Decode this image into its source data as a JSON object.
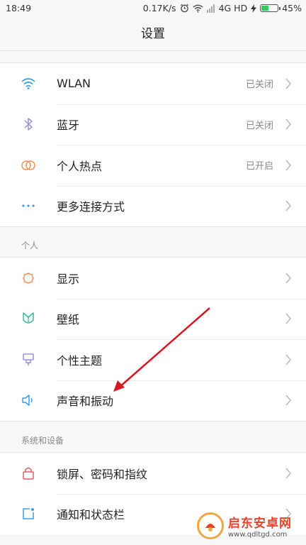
{
  "status_bar": {
    "time": "18:49",
    "net_speed": "0.17K/s",
    "network": "4G HD",
    "battery": "45%",
    "battery_level": 0.45
  },
  "header": {
    "title": "设置"
  },
  "groups": {
    "connection": [
      {
        "label": "WLAN",
        "value": "已关闭",
        "icon": "wifi-icon"
      },
      {
        "label": "蓝牙",
        "value": "已关闭",
        "icon": "bluetooth-icon"
      },
      {
        "label": "个人热点",
        "value": "已开启",
        "icon": "hotspot-icon"
      },
      {
        "label": "更多连接方式",
        "value": "",
        "icon": "more-icon"
      }
    ],
    "personal_title": "个人",
    "personal": [
      {
        "label": "显示",
        "icon": "display-icon"
      },
      {
        "label": "壁纸",
        "icon": "wallpaper-icon"
      },
      {
        "label": "个性主题",
        "icon": "theme-icon"
      },
      {
        "label": "声音和振动",
        "icon": "sound-icon"
      }
    ],
    "system_title": "系统和设备",
    "system": [
      {
        "label": "锁屏、密码和指纹",
        "icon": "lock-icon"
      },
      {
        "label": "通知和状态栏",
        "icon": "notification-icon"
      }
    ]
  },
  "watermark": {
    "title": "启东安卓网",
    "url": "www.qdltgd.com"
  },
  "colors": {
    "wifi": "#3a9ee4",
    "bluetooth": "#9b8fd6",
    "hotspot": "#f0935a",
    "more": "#3a9ee4",
    "display": "#f0935a",
    "wallpaper": "#3cb89d",
    "theme": "#9b8fd6",
    "sound": "#3a9ee4",
    "lock": "#e85b6a",
    "notification": "#3a9ee4",
    "annotation_arrow": "#d9141f"
  }
}
